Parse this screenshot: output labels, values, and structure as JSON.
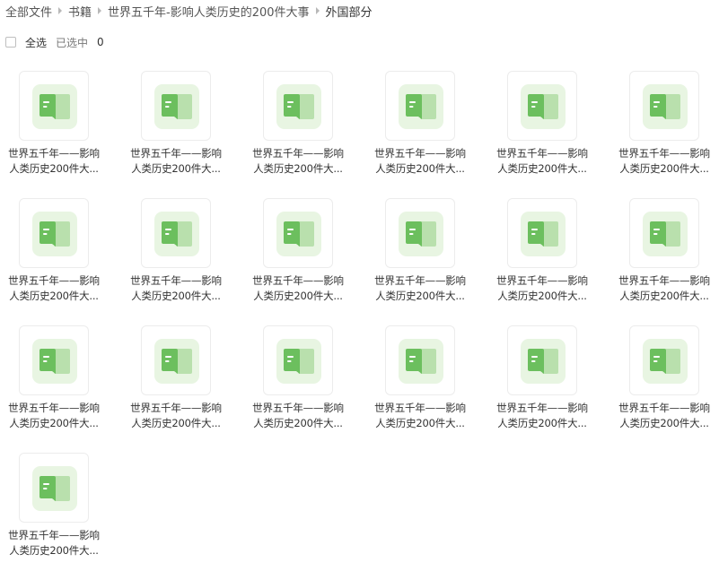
{
  "breadcrumb": [
    {
      "label": "全部文件",
      "current": false
    },
    {
      "label": "书籍",
      "current": false
    },
    {
      "label": "世界五千年-影响人类历史的200件大事",
      "current": false
    },
    {
      "label": "外国部分",
      "current": true
    }
  ],
  "selection": {
    "select_all_label": "全选",
    "selected_label": "已选中",
    "selected_count": "0"
  },
  "files": [
    {
      "line1": "世界五千年——影响",
      "line2": "人类历史200件大...",
      "icon": "book-icon"
    },
    {
      "line1": "世界五千年——影响",
      "line2": "人类历史200件大...",
      "icon": "book-icon"
    },
    {
      "line1": "世界五千年——影响",
      "line2": "人类历史200件大...",
      "icon": "book-icon"
    },
    {
      "line1": "世界五千年——影响",
      "line2": "人类历史200件大...",
      "icon": "book-icon"
    },
    {
      "line1": "世界五千年——影响",
      "line2": "人类历史200件大...",
      "icon": "book-icon"
    },
    {
      "line1": "世界五千年——影响",
      "line2": "人类历史200件大...",
      "icon": "book-icon"
    },
    {
      "line1": "世界五千年——影响",
      "line2": "人类历史200件大...",
      "icon": "book-icon"
    },
    {
      "line1": "世界五千年——影响",
      "line2": "人类历史200件大...",
      "icon": "book-icon"
    },
    {
      "line1": "世界五千年——影响",
      "line2": "人类历史200件大...",
      "icon": "book-icon"
    },
    {
      "line1": "世界五千年——影响",
      "line2": "人类历史200件大...",
      "icon": "book-icon"
    },
    {
      "line1": "世界五千年——影响",
      "line2": "人类历史200件大...",
      "icon": "book-icon"
    },
    {
      "line1": "世界五千年——影响",
      "line2": "人类历史200件大...",
      "icon": "book-icon"
    },
    {
      "line1": "世界五千年——影响",
      "line2": "人类历史200件大...",
      "icon": "book-icon"
    },
    {
      "line1": "世界五千年——影响",
      "line2": "人类历史200件大...",
      "icon": "book-icon"
    },
    {
      "line1": "世界五千年——影响",
      "line2": "人类历史200件大...",
      "icon": "book-icon"
    },
    {
      "line1": "世界五千年——影响",
      "line2": "人类历史200件大...",
      "icon": "book-icon"
    },
    {
      "line1": "世界五千年——影响",
      "line2": "人类历史200件大...",
      "icon": "book-icon"
    },
    {
      "line1": "世界五千年——影响",
      "line2": "人类历史200件大...",
      "icon": "book-icon"
    },
    {
      "line1": "世界五千年——影响",
      "line2": "人类历史200件大...",
      "icon": "book-icon"
    }
  ],
  "colors": {
    "icon_dark_green": "#6cbf5e",
    "icon_light_green": "#b9e0ad",
    "icon_background": "#e8f5e2"
  }
}
